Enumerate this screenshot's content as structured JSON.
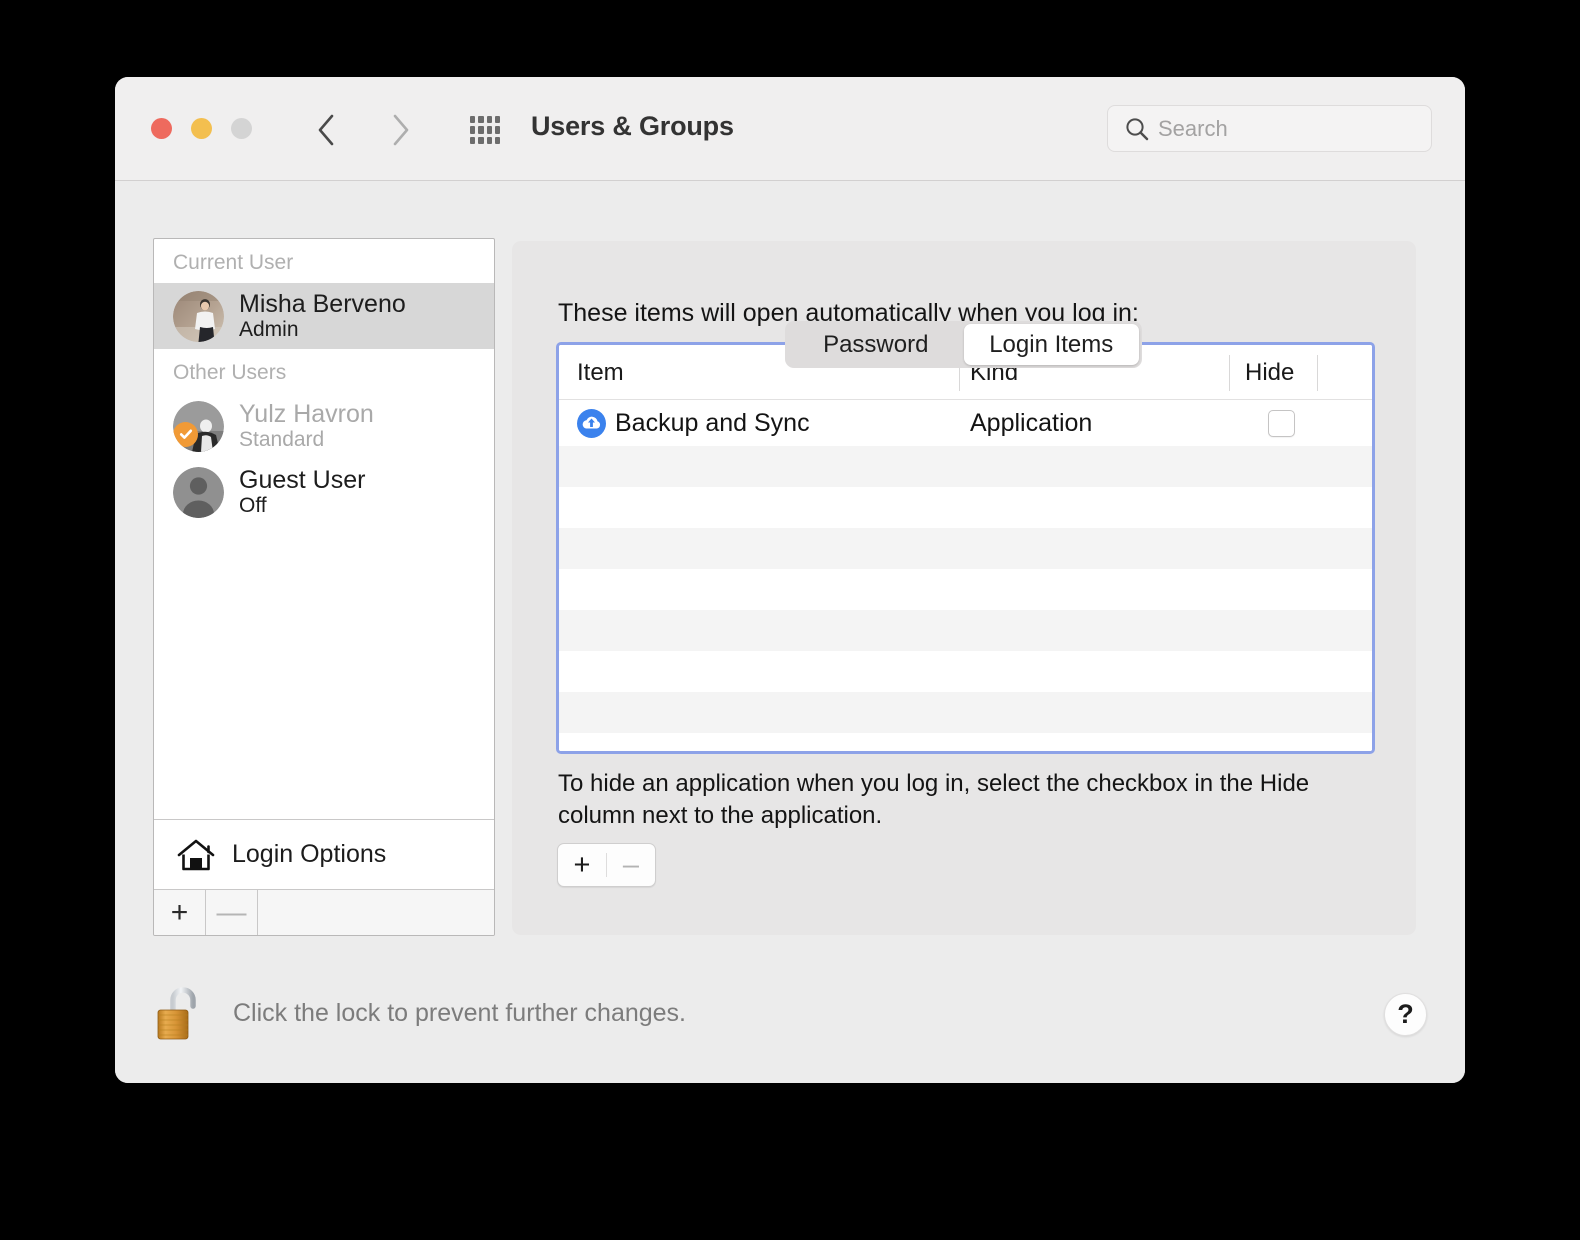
{
  "window": {
    "title": "Users & Groups",
    "traffic_lights": {
      "close": "close-button",
      "minimize": "minimize-button",
      "zoom": "zoom-button"
    },
    "nav": {
      "back": "back-arrow",
      "forward": "forward-arrow"
    },
    "grid_icon": "show-all-grid-icon"
  },
  "search": {
    "placeholder": "Search",
    "value": "",
    "icon": "search-icon"
  },
  "sidebar": {
    "groups": [
      {
        "header": "Current User",
        "users": [
          {
            "name": "Misha Berveno",
            "role": "Admin",
            "selected": true,
            "dim": false,
            "avatar": "photo-person-wall",
            "badge": null
          }
        ]
      },
      {
        "header": "Other Users",
        "users": [
          {
            "name": "Yulz Havron",
            "role": "Standard",
            "selected": false,
            "dim": true,
            "avatar": "photo-person-gray",
            "badge": "orange-check-badge"
          },
          {
            "name": "Guest User",
            "role": "Off",
            "selected": false,
            "dim": false,
            "avatar": "default-person-silhouette",
            "badge": null
          }
        ]
      }
    ],
    "login_options": {
      "label": "Login Options",
      "icon": "home-icon"
    },
    "footer": {
      "add": "+",
      "remove": "—"
    }
  },
  "tabs": [
    {
      "label": "Password",
      "active": false
    },
    {
      "label": "Login Items",
      "active": true
    }
  ],
  "panel": {
    "intro": "These items will open automatically when you log in:",
    "hint": "To hide an application when you log in, select the checkbox in the Hide column next to the application.",
    "add_remove": {
      "add": "+",
      "remove": "–"
    }
  },
  "table": {
    "columns": [
      "Item",
      "Kind",
      "Hide"
    ],
    "rows": [
      {
        "item": "Backup and Sync",
        "kind": "Application",
        "hide_checked": false,
        "icon": "cloud-upload-icon"
      }
    ],
    "empty_row_count": 8
  },
  "footer": {
    "lock_text": "Click the lock to prevent further changes.",
    "lock_icon": "unlocked-padlock-icon",
    "help_label": "?"
  },
  "colors": {
    "accent_focus_ring": "#8da2e8",
    "app_icon_blue": "#3b82ed",
    "badge_orange": "#f19a36",
    "window_bg": "#ececec",
    "toolbar_bg": "#f0efef",
    "panel_bg": "#e7e6e6",
    "selected_row": "#d7d7d7"
  }
}
